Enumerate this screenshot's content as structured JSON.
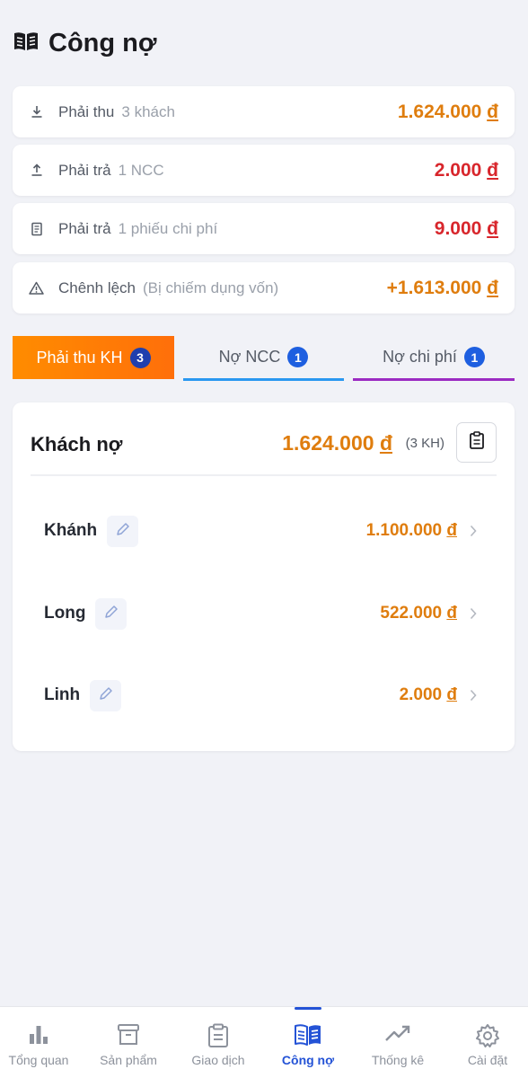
{
  "header": {
    "title": "Công nợ",
    "icon": "book-open-icon"
  },
  "summary": [
    {
      "icon": "download-icon",
      "label": "Phải thu",
      "sub": "3 khách",
      "amount": "1.624.000",
      "currency": "đ",
      "color": "#df7d0e"
    },
    {
      "icon": "upload-icon",
      "label": "Phải trả",
      "sub": "1 NCC",
      "amount": "2.000",
      "currency": "đ",
      "color": "#d8262c"
    },
    {
      "icon": "receipt-icon",
      "label": "Phải trả",
      "sub": "1 phiếu chi phí",
      "amount": "9.000",
      "currency": "đ",
      "color": "#d8262c"
    },
    {
      "icon": "warning-icon",
      "label": "Chênh lệch",
      "sub": "(Bị chiếm dụng vốn)",
      "amount": "+1.613.000",
      "currency": "đ",
      "color": "#df7d0e"
    }
  ],
  "tabs": [
    {
      "label": "Phải thu KH",
      "count": "3",
      "active": true
    },
    {
      "label": "Nợ NCC",
      "count": "1",
      "active": false
    },
    {
      "label": "Nợ chi phí",
      "count": "1",
      "active": false
    }
  ],
  "panel": {
    "title": "Khách nợ",
    "total": "1.624.000",
    "currency": "đ",
    "count": "(3 KH)",
    "rows": [
      {
        "name": "Khánh",
        "amount": "1.100.000",
        "currency": "đ"
      },
      {
        "name": "Long",
        "amount": "522.000",
        "currency": "đ"
      },
      {
        "name": "Linh",
        "amount": "2.000",
        "currency": "đ"
      }
    ]
  },
  "nav": [
    {
      "label": "Tổng quan",
      "icon": "bar-chart-icon",
      "active": false
    },
    {
      "label": "Sản phẩm",
      "icon": "archive-box-icon",
      "active": false
    },
    {
      "label": "Giao dịch",
      "icon": "clipboard-icon",
      "active": false
    },
    {
      "label": "Công nợ",
      "icon": "book-open-icon",
      "active": true
    },
    {
      "label": "Thống kê",
      "icon": "trending-up-icon",
      "active": false
    },
    {
      "label": "Cài đặt",
      "icon": "gear-icon",
      "active": false
    }
  ],
  "colors": {
    "accent": "#2453d6",
    "orange": "#df7d0e",
    "red": "#d8262c",
    "ncc_tab": "#2a98f0",
    "cost_tab": "#9c2bc2"
  }
}
